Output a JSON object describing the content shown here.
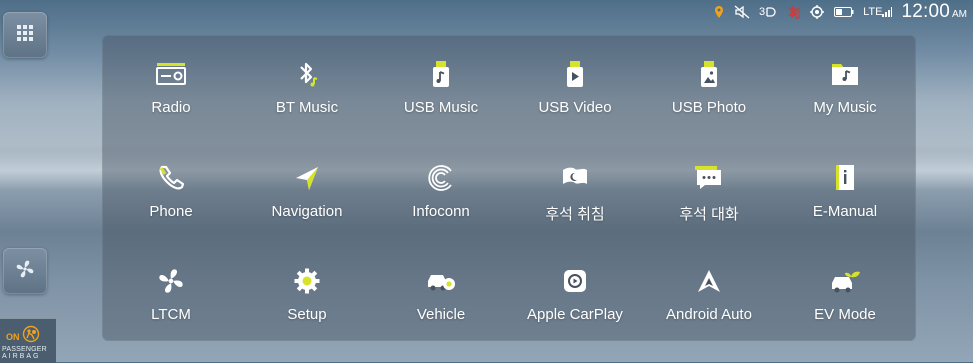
{
  "status_bar": {
    "icons": [
      "location-icon",
      "mute-icon",
      "3g-indicator",
      "bluetooth-battery-icon",
      "settings-sync-icon",
      "battery-icon"
    ],
    "network_sub": "3",
    "network_label": "LTE",
    "clock": "12:00",
    "ampm": "AM"
  },
  "side": {
    "menu_icon": "grid-menu-icon",
    "fan_icon": "fan-icon"
  },
  "airbag": {
    "status": "ON",
    "line1": "PASSENGER",
    "line2": "AIRBAG"
  },
  "colors": {
    "accent": "#d7e32a",
    "panel": "#46525f",
    "text": "#ffffff"
  },
  "apps": [
    {
      "label": "Radio",
      "icon": "radio-icon"
    },
    {
      "label": "BT Music",
      "icon": "bluetooth-music-icon"
    },
    {
      "label": "USB Music",
      "icon": "usb-music-icon"
    },
    {
      "label": "USB Video",
      "icon": "usb-video-icon"
    },
    {
      "label": "USB Photo",
      "icon": "usb-photo-icon"
    },
    {
      "label": "My Music",
      "icon": "folder-music-icon"
    },
    {
      "label": "Phone",
      "icon": "phone-icon"
    },
    {
      "label": "Navigation",
      "icon": "navigation-icon"
    },
    {
      "label": "Infoconn",
      "icon": "infoconn-icon"
    },
    {
      "label": "후석 취침",
      "icon": "rear-sleep-icon"
    },
    {
      "label": "후석 대화",
      "icon": "rear-chat-icon"
    },
    {
      "label": "E-Manual",
      "icon": "manual-icon"
    },
    {
      "label": "LTCM",
      "icon": "fan-icon"
    },
    {
      "label": "Setup",
      "icon": "gear-icon"
    },
    {
      "label": "Vehicle",
      "icon": "vehicle-icon"
    },
    {
      "label": "Apple CarPlay",
      "icon": "carplay-icon"
    },
    {
      "label": "Android Auto",
      "icon": "android-auto-icon"
    },
    {
      "label": "EV Mode",
      "icon": "ev-mode-icon"
    }
  ]
}
